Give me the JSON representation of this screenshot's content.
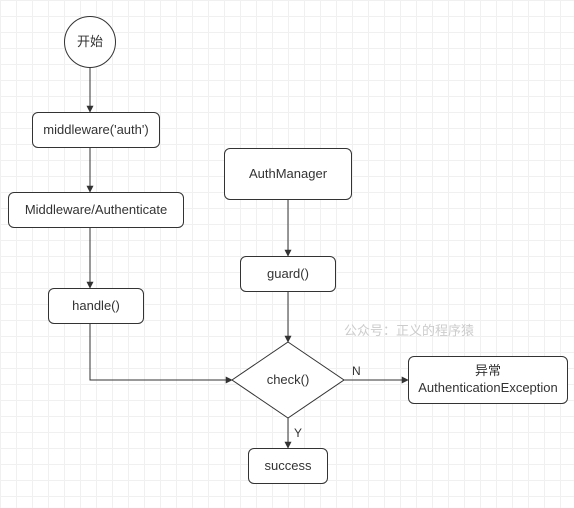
{
  "nodes": {
    "start": "开始",
    "mw_auth": "middleware('auth')",
    "mw_authenticate": "Middleware/Authenticate",
    "handle": "handle()",
    "auth_manager": "AuthManager",
    "guard": "guard()",
    "check": "check()",
    "success": "success",
    "exception_line1": "异常",
    "exception_line2": "AuthenticationException"
  },
  "edges": {
    "yes": "Y",
    "no": "N"
  },
  "watermark": "公众号：正义的程序猿"
}
